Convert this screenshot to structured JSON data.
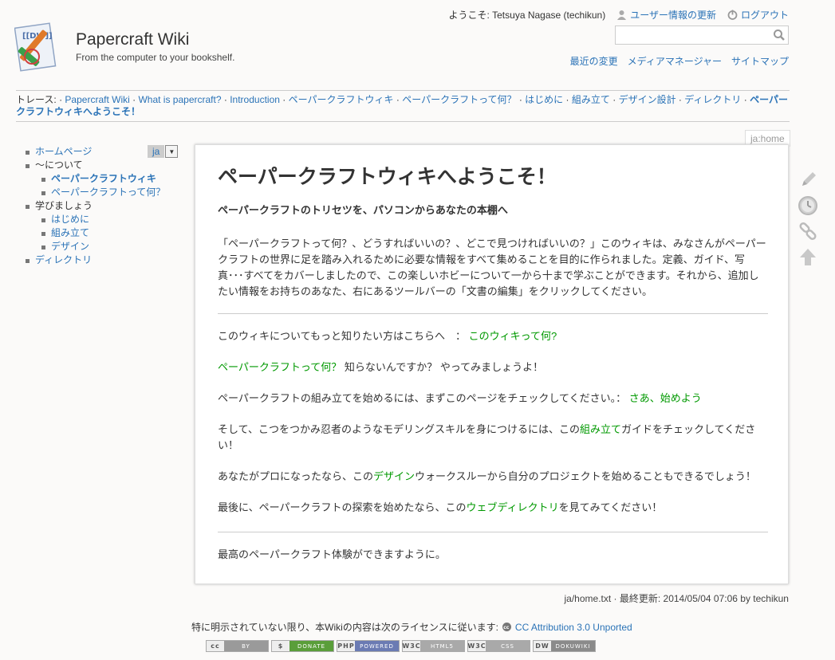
{
  "site": {
    "title": "Papercraft Wiki",
    "tagline": "From the computer to your bookshelf."
  },
  "user_tools": {
    "welcome": "ようこそ: Tetsuya Nagase (techikun)",
    "profile": "ユーザー情報の更新",
    "logout": "ログアウト"
  },
  "search": {
    "value": "",
    "placeholder": ""
  },
  "site_tools": [
    "最近の変更",
    "メディアマネージャー",
    "サイトマップ"
  ],
  "trace": {
    "label": "トレース:",
    "items": [
      "Papercraft Wiki",
      "What is papercraft?",
      "Introduction",
      "ペーパークラフトウィキ",
      "ペーパークラフトって何？",
      "はじめに",
      "組み立て",
      "デザイン設計",
      "ディレクトリ"
    ],
    "current": "ペーパークラフトウィキへようこそ！"
  },
  "sidebar": {
    "home": "ホームページ",
    "about": "〜について",
    "about_items": [
      "ペーパークラフトウィキ",
      "ペーパークラフトって何？"
    ],
    "learn": "学びましょう",
    "learn_items": [
      "はじめに",
      "組み立て",
      "デザイン"
    ],
    "directory": "ディレクトリ"
  },
  "language": {
    "selected": "ja"
  },
  "page": {
    "id": "ja:home",
    "title": "ペーパークラフトウィキへようこそ！",
    "subtitle": "ペーパークラフトのトリセツを、パソコンからあなたの本棚へ",
    "intro": "「ペーパークラフトって何？、どうすればいいの？、どこで見つければいいの？」このウィキは、みなさんがペーパークラフトの世界に足を踏み入れるために必要な情報をすべて集めることを目的に作られました。定義、ガイド、写真･･･すべてをカバーしましたので、この楽しいホビーについて一から十まで学ぶことができます。それから、追加したい情報をお持ちのあなた、右にあるツールバーの「文書の編集」をクリックしてください。",
    "l1_text": "このウィキについてもっと知りたい方はこちらへ　：",
    "l1_link": "このウィキって何?",
    "l2_link": "ペーパークラフトって何？",
    "l2_text": "知らないんですか？ やってみましょうよ！",
    "l3_text": "ペーパークラフトの組み立てを始めるには、まずこのページをチェックしてください。：",
    "l3_link": "さあ、始めよう",
    "l4_pre": "そして、こつをつかみ忍者のようなモデリングスキルを身につけるには、この",
    "l4_link": "組み立て",
    "l4_post": "ガイドをチェックしてください！",
    "l5_pre": "あなたがプロになったなら、この",
    "l5_link": "デザイン",
    "l5_post": "ウォークスルーから自分のプロジェクトを始めることもできるでしょう！",
    "l6_pre": "最後に、ペーパークラフトの探索を始めたなら、この",
    "l6_link": "ウェブディレクトリ",
    "l6_post": "を見てみてください！",
    "closing": "最高のペーパークラフト体験ができますように。"
  },
  "footer": {
    "docinfo": "ja/home.txt · 最終更新: 2014/05/04 07:06 by techikun",
    "license_text": "特に明示されていない限り、本Wikiの内容は次のライセンスに従います:",
    "license_link": "CC Attribution 3.0 Unported",
    "badges": [
      {
        "left": "cc",
        "right": "BY",
        "color": "#9a9a9a"
      },
      {
        "left": "$",
        "right": "DONATE",
        "color": "#5a9e3a"
      },
      {
        "left": "PHP",
        "right": "POWERED",
        "color": "#6b7bb3"
      },
      {
        "left": "W3C",
        "right": "HTML5",
        "color": "#a9a9a9"
      },
      {
        "left": "W3C",
        "right": "CSS",
        "color": "#a9a9a9"
      },
      {
        "left": "DW",
        "right": "DOKUWIKI",
        "color": "#8a8a8a"
      }
    ]
  }
}
